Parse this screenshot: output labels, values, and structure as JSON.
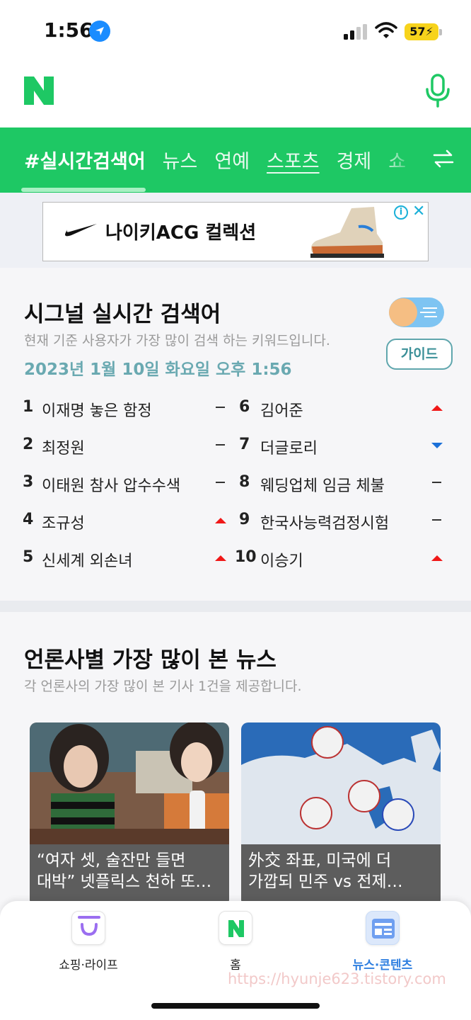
{
  "status": {
    "time": "1:56",
    "battery": "57"
  },
  "nav": {
    "tabs": [
      {
        "label": "#실시간검색어",
        "active": true
      },
      {
        "label": "뉴스"
      },
      {
        "label": "연예"
      },
      {
        "label": "스포츠"
      },
      {
        "label": "경제"
      },
      {
        "label": "쇼"
      }
    ]
  },
  "ad": {
    "text": "나이키ACG 컬렉션"
  },
  "realtime": {
    "title": "시그널 실시간 검색어",
    "subtitle": "현재 기준 사용자가 가장 많이 검색 하는 키워드입니다.",
    "datetime": "2023년 1월 10일 화요일 오후 1:56",
    "guide_label": "가이드",
    "items": [
      {
        "rank": "1",
        "keyword": "이재명 놓은 함정",
        "change": "same"
      },
      {
        "rank": "2",
        "keyword": "최정원",
        "change": "same"
      },
      {
        "rank": "3",
        "keyword": "이태원 참사 압수수색",
        "change": "same"
      },
      {
        "rank": "4",
        "keyword": "조규성",
        "change": "up"
      },
      {
        "rank": "5",
        "keyword": "신세계 외손녀",
        "change": "up"
      },
      {
        "rank": "6",
        "keyword": "김어준",
        "change": "up"
      },
      {
        "rank": "7",
        "keyword": "더글로리",
        "change": "down"
      },
      {
        "rank": "8",
        "keyword": "웨딩업체 임금 체불",
        "change": "same"
      },
      {
        "rank": "9",
        "keyword": "한국사능력검정시험",
        "change": "same"
      },
      {
        "rank": "10",
        "keyword": "이승기",
        "change": "up"
      }
    ]
  },
  "news": {
    "title": "언론사별 가장 많이 본 뉴스",
    "subtitle": "각 언론사의 가장 많이 본 기사 1건을 제공합니다.",
    "cards": [
      {
        "line1": "“여자 셋, 술잔만 들면",
        "line2": "대박” 넷플릭스 천하 또…"
      },
      {
        "line1": "外交 좌표, 미국에 더",
        "line2": "가깝되 민주 vs 전제…"
      }
    ]
  },
  "tabbar": {
    "shopping": "쇼핑·라이프",
    "home": "홈",
    "news": "뉴스·콘텐츠"
  },
  "watermark": "https://hyunje623.tistory.com",
  "colors": {
    "brand_green": "#1ec864",
    "up": "#f01818",
    "down": "#1b70d8",
    "accent_blue": "#2f7fe0"
  }
}
